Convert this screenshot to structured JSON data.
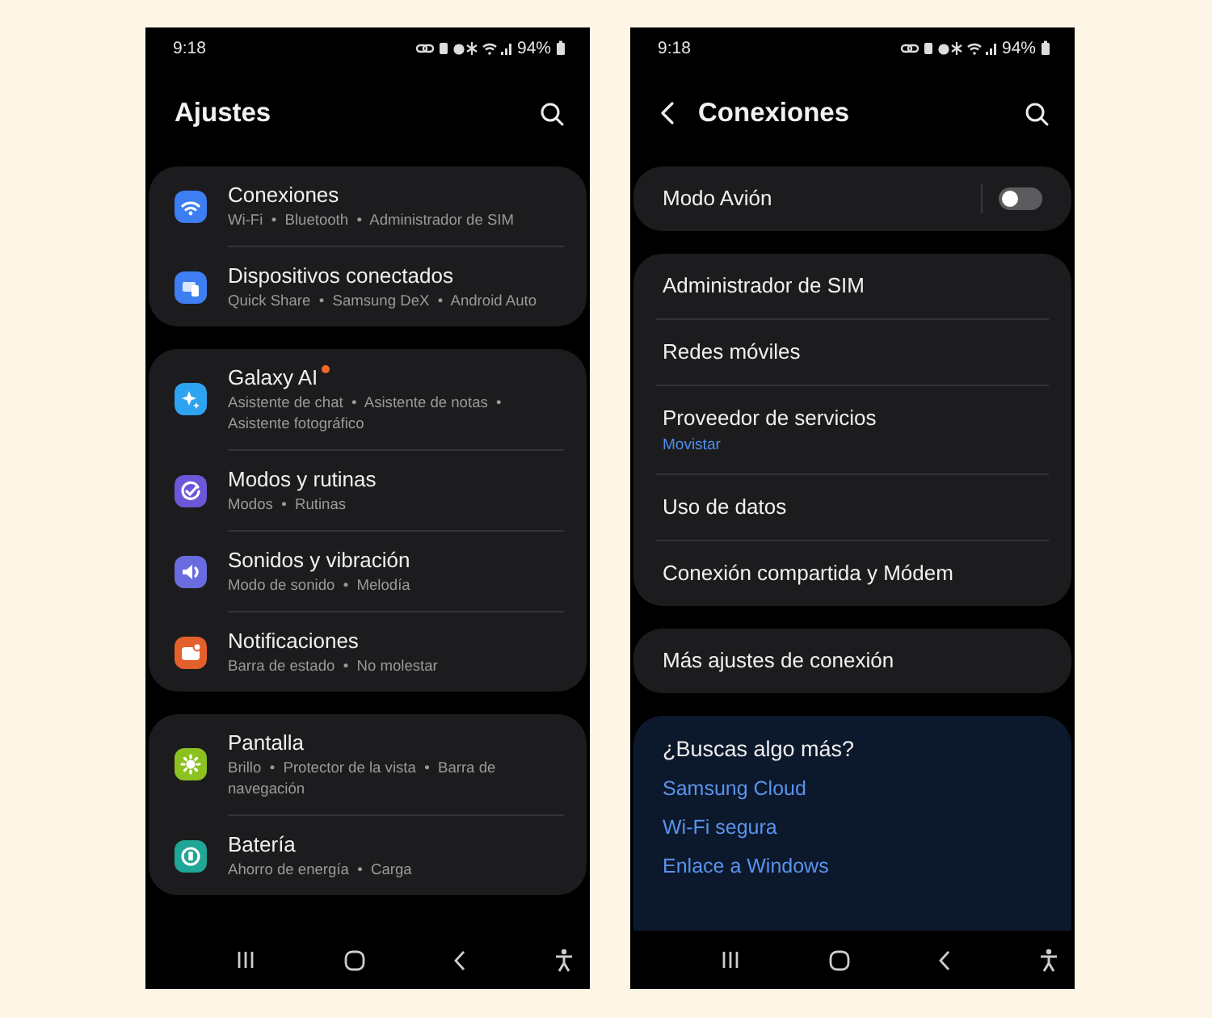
{
  "screens": [
    {
      "status_bar": {
        "time": "9:18",
        "battery": "94%"
      },
      "header": {
        "title": "Ajustes",
        "back": false
      },
      "groups": [
        {
          "kind": "menu",
          "items": [
            {
              "title": "Conexiones",
              "subtitle": "Wi-Fi  •  Bluetooth  •  Administrador de SIM",
              "color": "#3d7ef2",
              "badge": false
            },
            {
              "title": "Dispositivos conectados",
              "subtitle": "Quick Share  •  Samsung DeX  •  Android Auto",
              "color": "#3d7ef2",
              "badge": false
            }
          ]
        },
        {
          "kind": "menu",
          "items": [
            {
              "title": "Galaxy AI",
              "subtitle": "Asistente de chat  •  Asistente de notas  •  Asistente fotográfico",
              "color": "#2ea3f2",
              "badge": true
            },
            {
              "title": "Modos y rutinas",
              "subtitle": "Modos  •  Rutinas",
              "color": "#6a58d8",
              "badge": false
            },
            {
              "title": "Sonidos y vibración",
              "subtitle": "Modo de sonido  •  Melodía",
              "color": "#6b6be0",
              "badge": false
            },
            {
              "title": "Notificaciones",
              "subtitle": "Barra de estado  •  No molestar",
              "color": "#e4602a",
              "badge": false
            }
          ]
        },
        {
          "kind": "menu",
          "items": [
            {
              "title": "Pantalla",
              "subtitle": "Brillo  •  Protector de la vista  •  Barra de navegación",
              "color": "#8cc21f",
              "badge": false
            },
            {
              "title": "Batería",
              "subtitle": "Ahorro de energía  •  Carga",
              "color": "#1fa696",
              "badge": false
            }
          ]
        }
      ]
    },
    {
      "status_bar": {
        "time": "9:18",
        "battery": "94%"
      },
      "header": {
        "title": "Conexiones",
        "back": true
      },
      "groups": [
        {
          "kind": "list",
          "items": [
            {
              "title": "Modo Avión",
              "kind": "toggle",
              "on": false
            }
          ]
        },
        {
          "kind": "list",
          "items": [
            {
              "title": "Administrador de SIM",
              "kind": "plain"
            },
            {
              "title": "Redes móviles",
              "kind": "plain"
            },
            {
              "title": "Proveedor de servicios",
              "subtitle": "Movistar",
              "kind": "plain"
            },
            {
              "title": "Uso de datos",
              "kind": "plain"
            },
            {
              "title": "Conexión compartida y Módem",
              "kind": "plain"
            }
          ]
        },
        {
          "kind": "list",
          "items": [
            {
              "title": "Más ajustes de conexión",
              "kind": "plain"
            }
          ]
        },
        {
          "kind": "suggestions",
          "heading": "¿Buscas algo más?",
          "links": [
            "Samsung Cloud",
            "Wi-Fi segura",
            "Enlace a Windows"
          ]
        }
      ]
    }
  ]
}
